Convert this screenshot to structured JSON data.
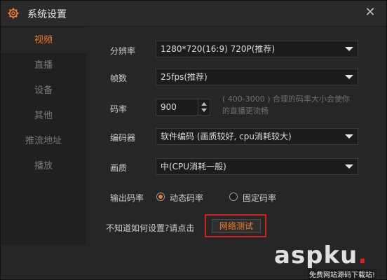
{
  "window": {
    "title": "系统设置",
    "icons": {
      "settings": "gear-icon",
      "close": "close-icon"
    }
  },
  "sidebar": {
    "items": [
      {
        "label": "视频",
        "active": true
      },
      {
        "label": "直播",
        "active": false
      },
      {
        "label": "设备",
        "active": false
      },
      {
        "label": "其他",
        "active": false
      },
      {
        "label": "推流地址",
        "active": false
      },
      {
        "label": "播放",
        "active": false
      }
    ]
  },
  "form": {
    "resolution": {
      "label": "分辨率",
      "value": "1280*720(16:9) 720P(推荐)"
    },
    "fps": {
      "label": "帧数",
      "value": "25fps(推荐)"
    },
    "bitrate": {
      "label": "码率",
      "value": "900",
      "note": "( 400-3000 ) 合理的码率大小会使你的直播更流畅"
    },
    "encoder": {
      "label": "编码器",
      "value": "软件编码 (画质较好, cpu消耗较大)"
    },
    "quality": {
      "label": "画质",
      "value": "中(CPU消耗一般)"
    },
    "output_bitrate": {
      "label": "输出码率",
      "options": [
        {
          "label": "动态码率",
          "checked": true
        },
        {
          "label": "固定码率",
          "checked": false
        }
      ]
    },
    "help": {
      "text": "不知道如何设置?请点击",
      "button": "网络测试"
    }
  },
  "colors": {
    "accent": "#f07b2b",
    "highlight_border": "#d12020"
  },
  "watermark": {
    "brand": "aspku",
    "tagline": "免费网站源码下载站!"
  }
}
